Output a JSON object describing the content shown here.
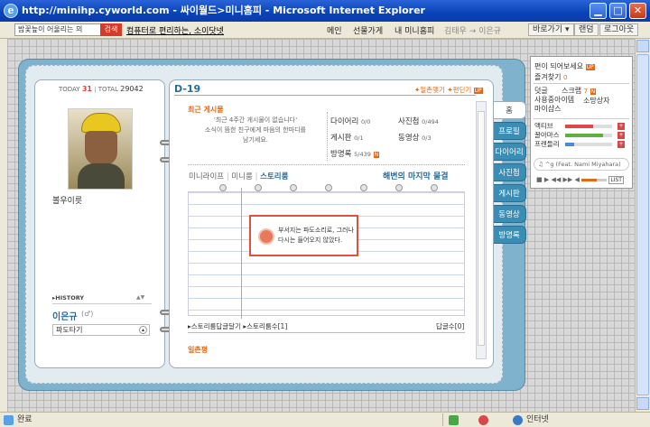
{
  "window": {
    "title": "http://minihp.cyworld.com - 싸이월드>미니홈피 - Microsoft Internet Explorer",
    "icon": "ie-logo-icon",
    "controls": [
      "minimize",
      "maximize",
      "close"
    ]
  },
  "toolbar": {
    "search_value": "밤꽃늪이 어울리는 의",
    "search_button": "검색",
    "ad_link": "컴퓨터로 편리하는, 소이닷넷",
    "menu": [
      "메인",
      "선물가게",
      "내 미니홈피"
    ],
    "user_path": "김태우 → 이은규",
    "goto_button": "바로가기 ▾",
    "random_button": "랜덤",
    "logout_button": "로그아웃"
  },
  "profile": {
    "today_label": "TODAY",
    "today_count": "31",
    "total_label": "TOTAL",
    "total_count": "29042",
    "status": "볼우이릇",
    "history_label": "▸HISTORY",
    "name": "이은규",
    "gender": "(♂)",
    "select_value": "파도타기"
  },
  "header": {
    "dday": "D-19",
    "ilchon_link": "✦일촌맺기",
    "ilchon_link2": "✦편딘기",
    "up_badge": "UP"
  },
  "recent": {
    "title": "최근 게시물",
    "empty_message": "'최근 4주간 게시물이 없습니다'\n소식이 뜸한 친구에게 마음의 한마디를\n남기세요.",
    "counts": [
      {
        "label": "다이어리",
        "value": "0/0"
      },
      {
        "label": "사진첩",
        "value": "0/494"
      },
      {
        "label": "게시판",
        "value": "0/1"
      },
      {
        "label": "동영상",
        "value": "0/3"
      },
      {
        "label": "방명록",
        "value": "5/439",
        "badge": "N"
      }
    ]
  },
  "story": {
    "tabs": [
      "미니라이프",
      "미니룸",
      "스토리룸"
    ],
    "title": "해변의 마지막 물결",
    "popup_message": "부서지는 파도소리로, 그러나 다시는 들어오지 않았다.",
    "footer_left": "▸스토리룸답글달기",
    "footer_mid": "▸스토리룸수[1]",
    "footer_right": "답글수[0]",
    "ilchon_label": "일촌평"
  },
  "tabs": [
    "홈",
    "프로필",
    "다이어리",
    "사진첩",
    "게시판",
    "동영상",
    "방명록"
  ],
  "minipanel": {
    "line1": "편이 되어보세요",
    "line1_badge": "UP",
    "line2": "즐겨찾기",
    "line2_count": "0",
    "col1": [
      "덧글",
      "사용중아이템",
      "마이샵스"
    ],
    "col2": [
      "스크랩",
      "소망상자"
    ],
    "col2_count": "7",
    "col2_badge": "N",
    "bars": [
      {
        "label": "액티브",
        "fraction": 0.6,
        "color": "#e04848"
      },
      {
        "label": "꿀아마스",
        "fraction": 0.8,
        "color": "#60b040"
      },
      {
        "label": "프렌들리",
        "fraction": 0.2,
        "color": "#4a8ad8"
      }
    ],
    "bgm": "♫ ^g (Feat. Nami Miyahara)",
    "list_label": "LIST"
  },
  "status": {
    "text": "완료",
    "zone": "인터넷"
  }
}
